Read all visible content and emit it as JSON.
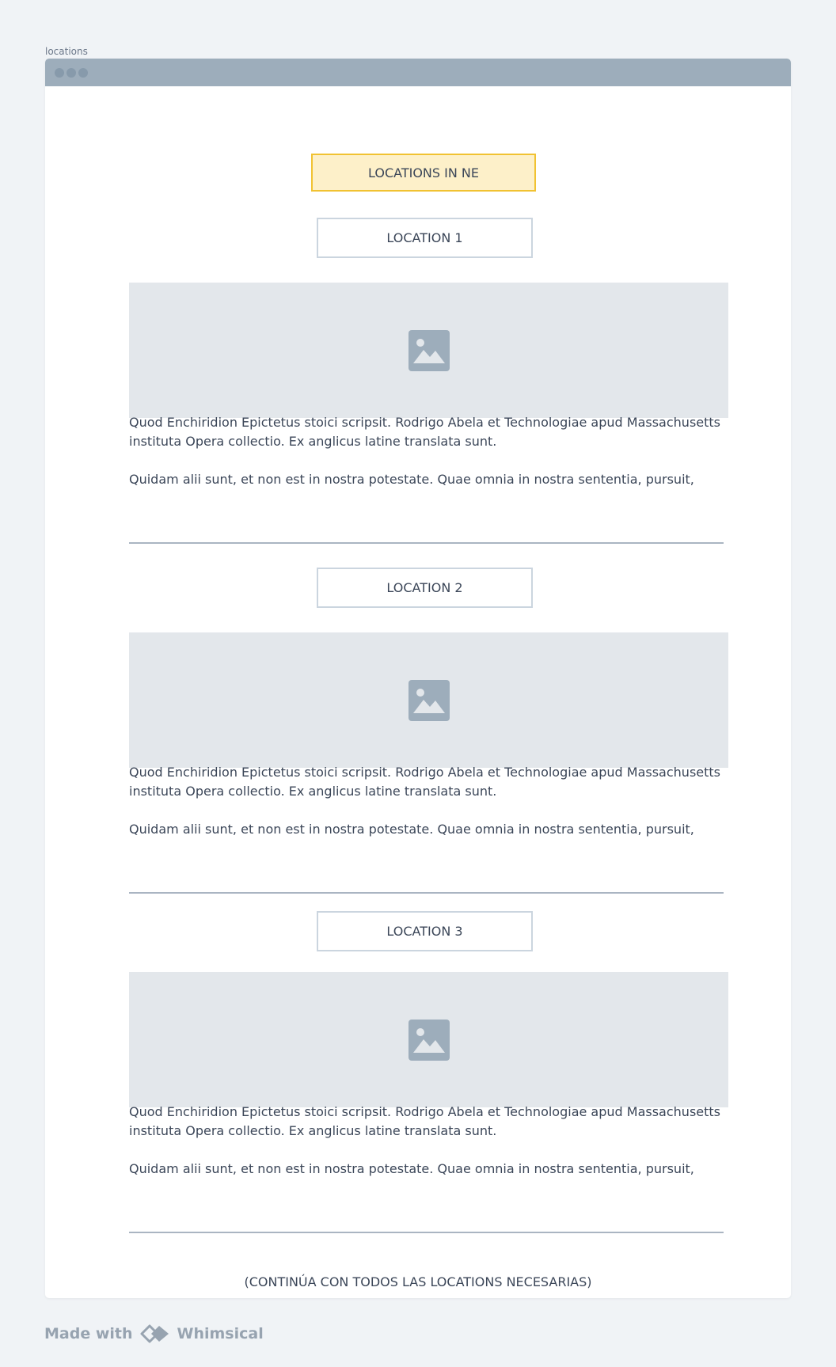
{
  "frame": {
    "label": "locations"
  },
  "header": {
    "title": "LOCATIONS IN NE"
  },
  "locations": [
    {
      "label": "LOCATION 1",
      "image_icon": "image-placeholder-icon",
      "paragraph1": "Quod Enchiridion Epictetus stoici scripsit. Rodrigo Abela et Technologiae apud Massachusetts instituta Opera collectio. Ex anglicus latine translata sunt.",
      "paragraph2": "Quidam alii sunt, et non est in nostra potestate. Quae omnia in nostra sententia, pursuit,"
    },
    {
      "label": "LOCATION 2",
      "image_icon": "image-placeholder-icon",
      "paragraph1": "Quod Enchiridion Epictetus stoici scripsit. Rodrigo Abela et Technologiae apud Massachusetts instituta Opera collectio. Ex anglicus latine translata sunt.",
      "paragraph2": "Quidam alii sunt, et non est in nostra potestate. Quae omnia in nostra sententia, pursuit,"
    },
    {
      "label": "LOCATION 3",
      "image_icon": "image-placeholder-icon",
      "paragraph1": "Quod Enchiridion Epictetus stoici scripsit. Rodrigo Abela et Technologiae apud Massachusetts instituta Opera collectio. Ex anglicus latine translata sunt.",
      "paragraph2": "Quidam alii sunt, et non est in nostra potestate. Quae omnia in nostra sententia, pursuit,"
    }
  ],
  "continue_note": "(CONTINÚA CON TODOS LAS LOCATIONS NECESARIAS)",
  "footer": {
    "made_with": "Made with",
    "brand": "Whimsical",
    "brand_icon": "whimsical-logo-icon"
  },
  "colors": {
    "background": "#f0f3f6",
    "titlebar": "#9dadbb",
    "highlight_fill": "#fdf0c9",
    "highlight_border": "#f1c232",
    "placeholder_fill": "#e3e7eb",
    "icon": "#9dadbb",
    "text": "#3b4658"
  }
}
